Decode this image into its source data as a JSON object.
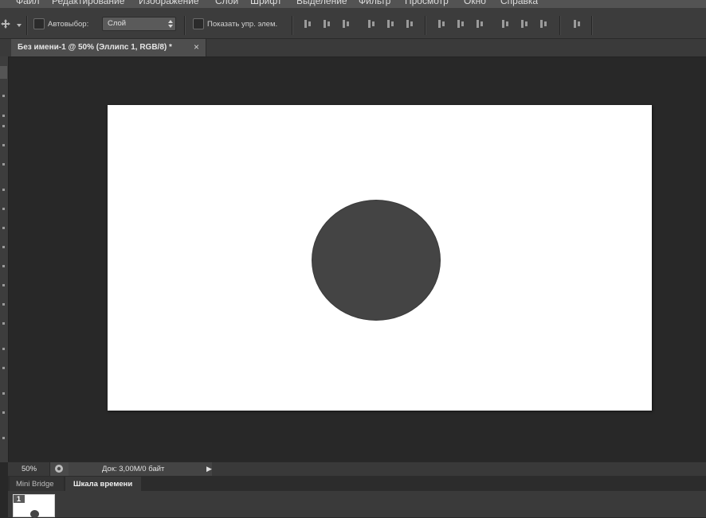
{
  "menu": {
    "items": [
      "Файл",
      "Редактирование",
      "Изображение",
      "Слои",
      "Шрифт",
      "Выделение",
      "Фильтр",
      "Просмотр",
      "Окно",
      "Справка"
    ]
  },
  "options": {
    "autoselect_label": "Автовыбор:",
    "autoselect_value": "Слой",
    "show_controls_label": "Показать упр. элем."
  },
  "document": {
    "tab_title": "Без имени-1 @ 50% (Эллипс 1, RGB/8) *",
    "close_glyph": "×"
  },
  "status": {
    "zoom": "50%",
    "doc_info": "Док: 3,00M/0 байт",
    "arrow_glyph": "▶"
  },
  "panels": {
    "tabs": [
      "Mini Bridge",
      "Шкала времени"
    ],
    "active_tab": "Шкала времени",
    "frame_number": "1"
  },
  "colors": {
    "canvas": "#ffffff",
    "ellipse": "#444444",
    "workspace": "#282828"
  }
}
